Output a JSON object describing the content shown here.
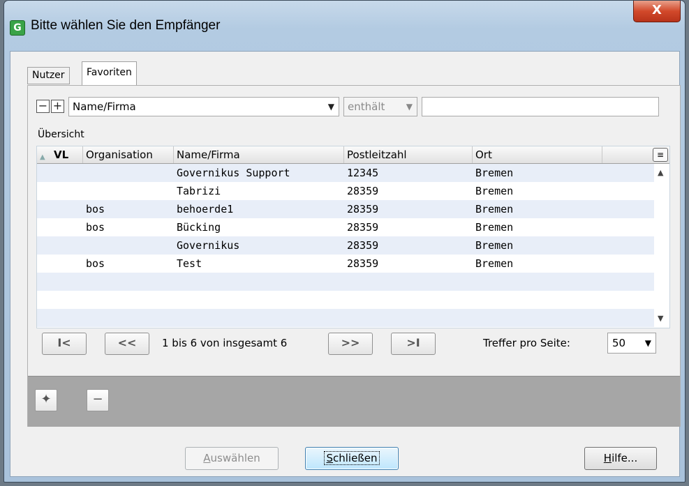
{
  "window": {
    "title": "Bitte wählen Sie den Empfänger",
    "app_icon": "G",
    "close_label": "X"
  },
  "tabs": [
    {
      "label": "Nutzer"
    },
    {
      "label": "Favoriten",
      "active": true
    }
  ],
  "filter": {
    "field": "Name/Firma",
    "operator": "enthält",
    "value": ""
  },
  "overview_label": "Übersicht",
  "table": {
    "columns": [
      "VL",
      "Organisation",
      "Name/Firma",
      "Postleitzahl",
      "Ort"
    ],
    "rows": [
      [
        "",
        "",
        "Governikus Support",
        "12345",
        "Bremen"
      ],
      [
        "",
        "",
        "Tabrizi",
        "28359",
        "Bremen"
      ],
      [
        "",
        "bos",
        "behoerde1",
        "28359",
        "Bremen"
      ],
      [
        "",
        "bos",
        "Bücking",
        "28359",
        "Bremen"
      ],
      [
        "",
        "",
        "Governikus",
        "28359",
        "Bremen"
      ],
      [
        "",
        "bos",
        "Test",
        "28359",
        "Bremen"
      ]
    ]
  },
  "pager": {
    "first": "I<",
    "prev": "<<",
    "next": ">>",
    "last": ">I",
    "status": "1 bis 6 von insgesamt 6",
    "hits_label": "Treffer pro Seite:",
    "hits_value": "50"
  },
  "buttons": {
    "select_rest": "uswählen",
    "select_mnemonic": "A",
    "close_rest": "chließen",
    "close_mnemonic": "S",
    "help_rest": "ilfe...",
    "help_mnemonic": "H"
  },
  "colors": {
    "close_button": "#d2492b",
    "row_alt": "#e8eef8",
    "bottom_strip": "#a6a6a6"
  }
}
